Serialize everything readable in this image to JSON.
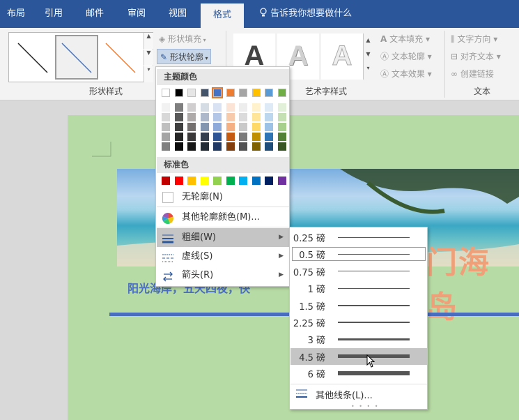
{
  "tabs": [
    {
      "label": "布局"
    },
    {
      "label": "引用"
    },
    {
      "label": "邮件"
    },
    {
      "label": "审阅"
    },
    {
      "label": "视图"
    },
    {
      "label": "格式"
    }
  ],
  "tell_me": "告诉我你想要做什么",
  "shape_styles": {
    "fill": "形状填充",
    "outline": "形状轮廓",
    "label": "形状样式",
    "line_colors": [
      "#222222",
      "#4472c4",
      "#ed7d31"
    ]
  },
  "wordart": {
    "letter": "A",
    "fill": "文本填充",
    "outline": "文本轮廓",
    "effect": "文本效果",
    "label": "艺术字样式"
  },
  "text_group": {
    "direction": "文字方向",
    "align": "对齐文本",
    "link": "创建链接",
    "label": "文本"
  },
  "document": {
    "subtitle": "阳光海岸，五天四夜，快",
    "title": "门海岛"
  },
  "outline_menu": {
    "theme_header": "主题颜色",
    "theme_colors": [
      "#ffffff",
      "#000000",
      "#e7e6e6",
      "#44546a",
      "#4472c4",
      "#ed7d31",
      "#a5a5a5",
      "#ffc000",
      "#5b9bd5",
      "#70ad47"
    ],
    "shades": [
      [
        "#f2f2f2",
        "#d8d8d8",
        "#bfbfbf",
        "#a5a5a5",
        "#7f7f7f"
      ],
      [
        "#7f7f7f",
        "#595959",
        "#3f3f3f",
        "#262626",
        "#0d0d0d"
      ],
      [
        "#d0cece",
        "#aeaaaa",
        "#757070",
        "#3a3838",
        "#171616"
      ],
      [
        "#d6dce4",
        "#adb9ca",
        "#8497b0",
        "#333f4f",
        "#222a35"
      ],
      [
        "#d9e2f3",
        "#b4c6e7",
        "#8eaadb",
        "#2f5496",
        "#1f3864"
      ],
      [
        "#fbe4d5",
        "#f7caac",
        "#f4b083",
        "#c55a11",
        "#833c0b"
      ],
      [
        "#ededed",
        "#dbdbdb",
        "#c9c9c9",
        "#7b7b7b",
        "#525252"
      ],
      [
        "#fff2cc",
        "#ffe598",
        "#ffd965",
        "#bf8f00",
        "#7f6000"
      ],
      [
        "#deebf6",
        "#bdd7ee",
        "#9cc3e5",
        "#2e75b5",
        "#1e4e79"
      ],
      [
        "#e2efd9",
        "#c5e0b3",
        "#a8d08d",
        "#538135",
        "#375623"
      ]
    ],
    "standard_header": "标准色",
    "standard_colors": [
      "#c00000",
      "#ff0000",
      "#ffc000",
      "#ffff00",
      "#92d050",
      "#00b050",
      "#00b0f0",
      "#0070c0",
      "#002060",
      "#7030a0"
    ],
    "no_outline": "无轮廓(N)",
    "more_colors": "其他轮廓颜色(M)...",
    "weight": "粗细(W)",
    "dashes": "虚线(S)",
    "arrows": "箭头(R)"
  },
  "weight_menu": {
    "items": [
      {
        "label": "0.25 磅",
        "pt": 0.25
      },
      {
        "label": "0.5 磅",
        "pt": 0.5
      },
      {
        "label": "0.75 磅",
        "pt": 0.75
      },
      {
        "label": "1 磅",
        "pt": 1
      },
      {
        "label": "1.5 磅",
        "pt": 1.5
      },
      {
        "label": "2.25 磅",
        "pt": 2.25
      },
      {
        "label": "3 磅",
        "pt": 3
      },
      {
        "label": "4.5 磅",
        "pt": 4.5
      },
      {
        "label": "6 磅",
        "pt": 6
      }
    ],
    "more": "其他线条(L)..."
  }
}
